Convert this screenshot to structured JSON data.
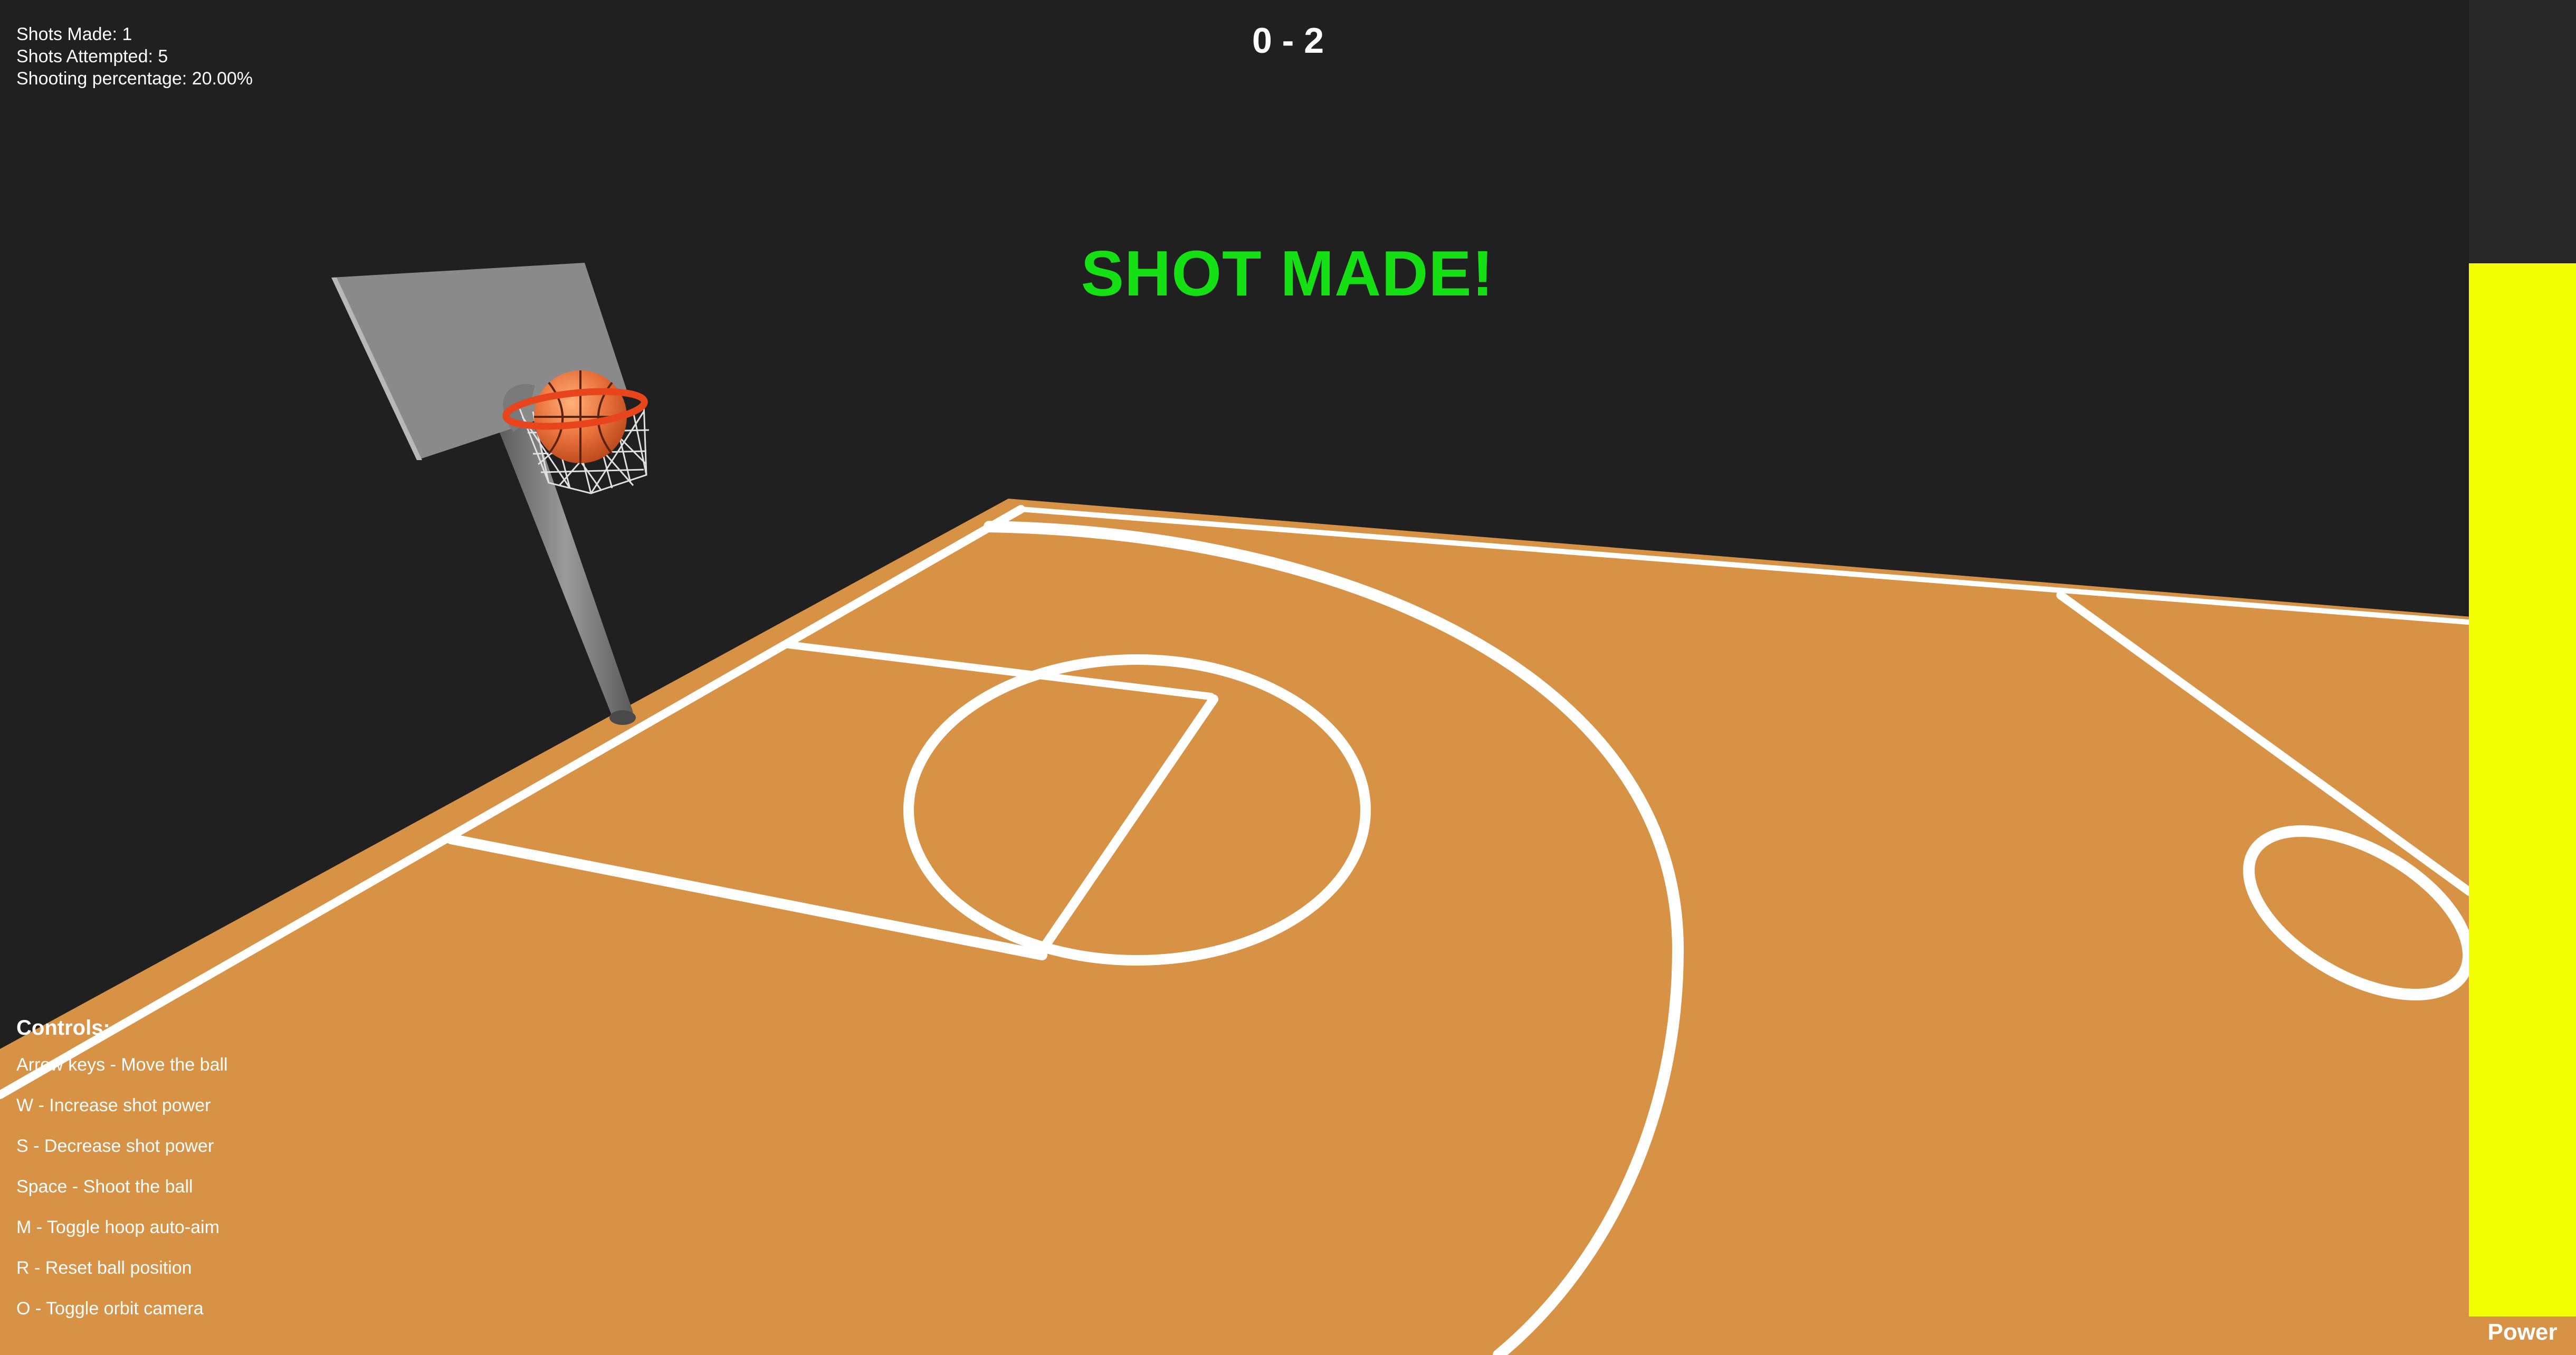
{
  "stats": {
    "shots_made": "Shots Made: 1",
    "shots_attempted": "Shots Attempted: 5",
    "shooting_percentage": "Shooting percentage: 20.00%"
  },
  "scoreboard": {
    "score": "0 - 2"
  },
  "message": {
    "text": "SHOT MADE!",
    "color": "#14e014"
  },
  "controls": {
    "title": "Controls:",
    "items": [
      "Arrow keys - Move the ball",
      "W - Increase shot power",
      "S - Decrease shot power",
      "Space - Shoot the ball",
      "M - Toggle hoop auto-aim",
      "R - Reset ball position",
      "O - Toggle orbit camera"
    ]
  },
  "power": {
    "label": "Power",
    "level": 0.8,
    "fill_color": "#f2ff00"
  },
  "colors": {
    "background": "#202020",
    "court": "#d79246",
    "lines": "#ffffff",
    "backboard": "#8c8c8c",
    "ball": "#e8703a",
    "rim": "#e8451c"
  }
}
